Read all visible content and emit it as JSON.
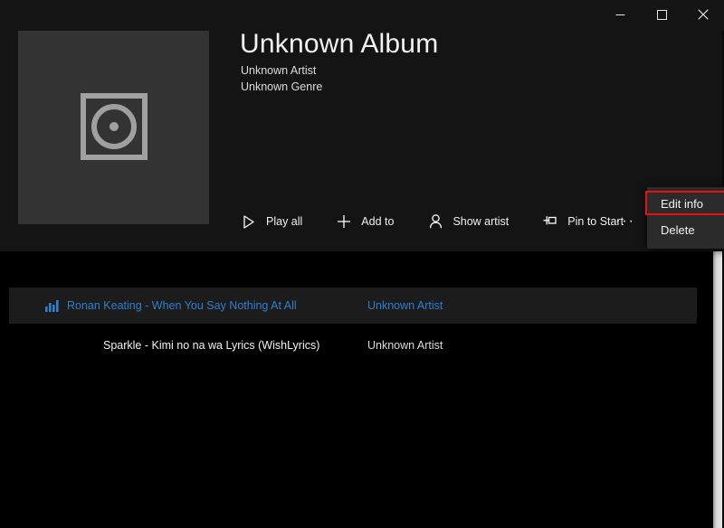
{
  "window": {
    "controls": [
      {
        "name": "minimize",
        "label": "─",
        "glyph": "minimize-icon"
      },
      {
        "name": "maximize",
        "label": "□",
        "glyph": "maximize-icon"
      },
      {
        "name": "close",
        "label": "✕",
        "glyph": "close-icon"
      }
    ]
  },
  "album": {
    "title": "Unknown Album",
    "artist": "Unknown Artist",
    "genre": "Unknown Genre",
    "art_placeholder_icon": "album-disc-icon"
  },
  "commandbar": {
    "items": [
      {
        "label": "Play all",
        "icon": "play-icon"
      },
      {
        "label": "Add to",
        "icon": "plus-icon"
      },
      {
        "label": "Show artist",
        "icon": "person-icon"
      },
      {
        "label": "Pin to Start",
        "icon": "pin-icon"
      }
    ],
    "more_label": "···",
    "more_icon": "more-ellipsis-icon"
  },
  "context_menu": {
    "items": [
      {
        "label": "Edit info",
        "highlighted": true
      },
      {
        "label": "Delete",
        "highlighted": false
      }
    ],
    "highlight_color": "#e81010"
  },
  "tracklist": {
    "rows": [
      {
        "title": "Ronan Keating - When You Say Nothing At All",
        "artist": "Unknown Artist",
        "selected": true,
        "icon": "equalizer-icon"
      },
      {
        "title": "Sparkle - Kimi no na wa Lyrics (WishLyrics)",
        "artist": "Unknown Artist",
        "selected": false,
        "icon": ""
      }
    ]
  },
  "colors": {
    "header_bg": "#141414",
    "body_bg": "#000000",
    "selected_row_bg": "#1c1c1c",
    "accent_blue": "#2f7fd0",
    "menu_bg": "#2b2b2b",
    "art_bg": "#333333"
  },
  "scrollbar": {
    "name": "vertical-scrollbar"
  }
}
